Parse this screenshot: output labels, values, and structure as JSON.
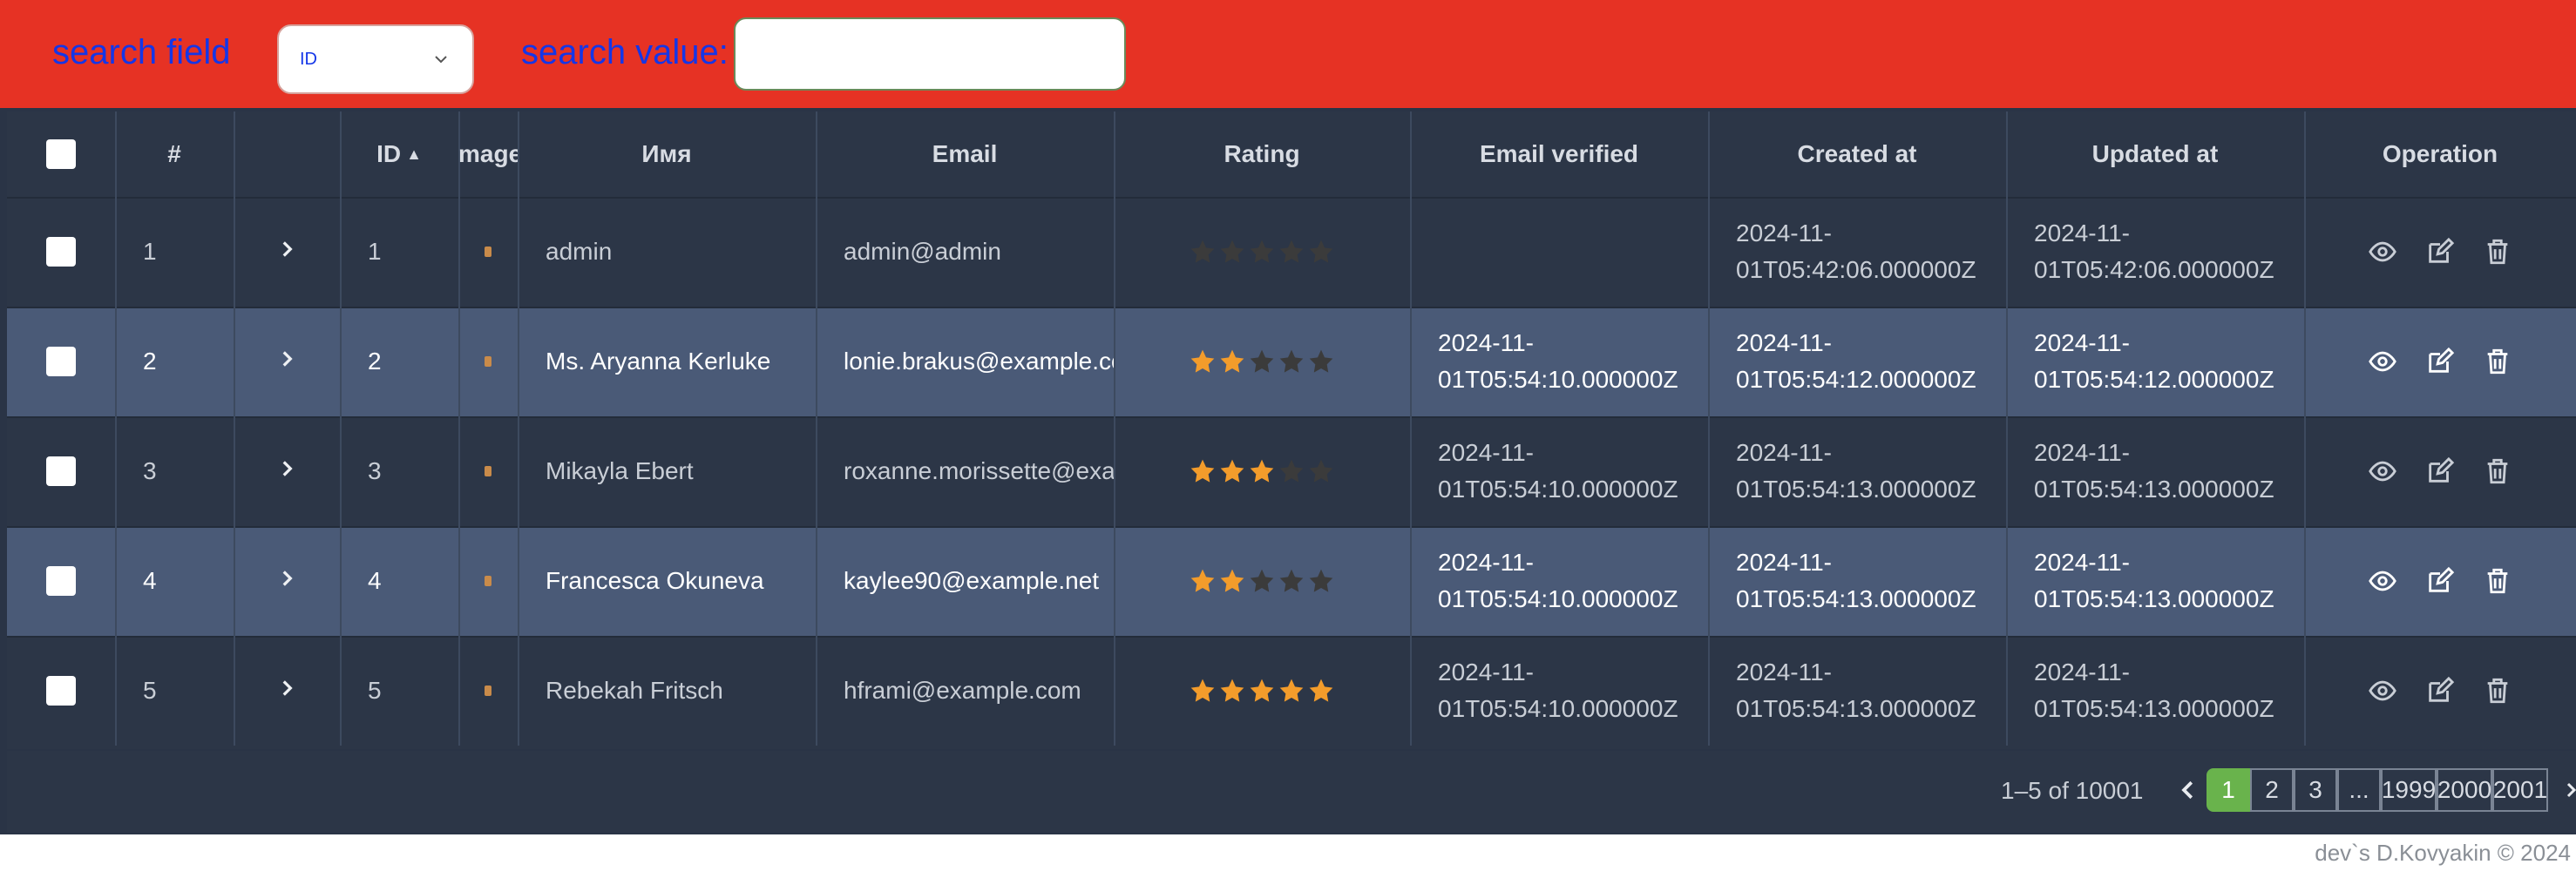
{
  "search": {
    "field_label": "search field",
    "field_value": "ID",
    "value_label": "search value:",
    "value": ""
  },
  "table": {
    "headers": [
      "",
      "#",
      "",
      "ID",
      "mage",
      "Имя",
      "Email",
      "Rating",
      "Email verified",
      "Created at",
      "Updated at",
      "Operation"
    ],
    "sort_indicator": "▲",
    "rows": [
      {
        "num": "1",
        "id": "1",
        "name": "admin",
        "email": "admin@admin",
        "rating": 0,
        "verified_1": "",
        "verified_2": "",
        "created_1": "2024-11-",
        "created_2": "01T05:42:06.000000Z",
        "updated_1": "2024-11-",
        "updated_2": "01T05:42:06.000000Z"
      },
      {
        "num": "2",
        "id": "2",
        "name": "Ms. Aryanna Kerluke",
        "email": "lonie.brakus@example.co",
        "rating": 2,
        "verified_1": "2024-11-",
        "verified_2": "01T05:54:10.000000Z",
        "created_1": "2024-11-",
        "created_2": "01T05:54:12.000000Z",
        "updated_1": "2024-11-",
        "updated_2": "01T05:54:12.000000Z"
      },
      {
        "num": "3",
        "id": "3",
        "name": "Mikayla Ebert",
        "email": "roxanne.morissette@exa",
        "rating": 3,
        "verified_1": "2024-11-",
        "verified_2": "01T05:54:10.000000Z",
        "created_1": "2024-11-",
        "created_2": "01T05:54:13.000000Z",
        "updated_1": "2024-11-",
        "updated_2": "01T05:54:13.000000Z"
      },
      {
        "num": "4",
        "id": "4",
        "name": "Francesca Okuneva",
        "email": "kaylee90@example.net",
        "rating": 2,
        "verified_1": "2024-11-",
        "verified_2": "01T05:54:10.000000Z",
        "created_1": "2024-11-",
        "created_2": "01T05:54:13.000000Z",
        "updated_1": "2024-11-",
        "updated_2": "01T05:54:13.000000Z"
      },
      {
        "num": "5",
        "id": "5",
        "name": "Rebekah Fritsch",
        "email": "hframi@example.com",
        "rating": 5,
        "verified_1": "2024-11-",
        "verified_2": "01T05:54:10.000000Z",
        "created_1": "2024-11-",
        "created_2": "01T05:54:13.000000Z",
        "updated_1": "2024-11-",
        "updated_2": "01T05:54:13.000000Z"
      }
    ]
  },
  "pagination": {
    "info": "1–5 of 10001",
    "pages": [
      "1",
      "2",
      "3",
      "...",
      "1999",
      "2000",
      "2001"
    ],
    "active": "1"
  },
  "footer": {
    "copyright": "dev`s D.Kovyakin © 2024"
  },
  "colors": {
    "topbar": "#e63224",
    "label": "#1436e8",
    "star_on": "#f39c2b",
    "star_off": "#3b3b3b",
    "active_page": "#69b34c"
  }
}
